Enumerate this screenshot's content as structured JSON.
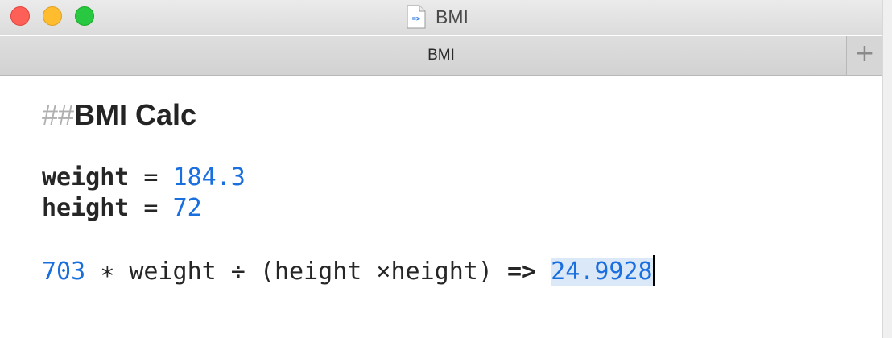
{
  "window": {
    "title": "BMI",
    "doc_icon_glyph": "=>"
  },
  "tabbar": {
    "active_tab_label": "BMI",
    "add_tab_symbol": "+"
  },
  "editor": {
    "heading_marker": "##",
    "heading_text": "BMI Calc",
    "line1": {
      "var": "weight",
      "op": " = ",
      "value": "184.3"
    },
    "line2": {
      "var": "height",
      "op": " = ",
      "value": "72"
    },
    "line3": {
      "constant": "703",
      "expr": " ∗ weight ÷ (height ×height) ",
      "arrow": "=>",
      "result": "24.9928"
    }
  },
  "colors": {
    "number": "#1a6fdf",
    "heading_marker": "#b0b0b0",
    "result_highlight": "#dbe8f8"
  }
}
